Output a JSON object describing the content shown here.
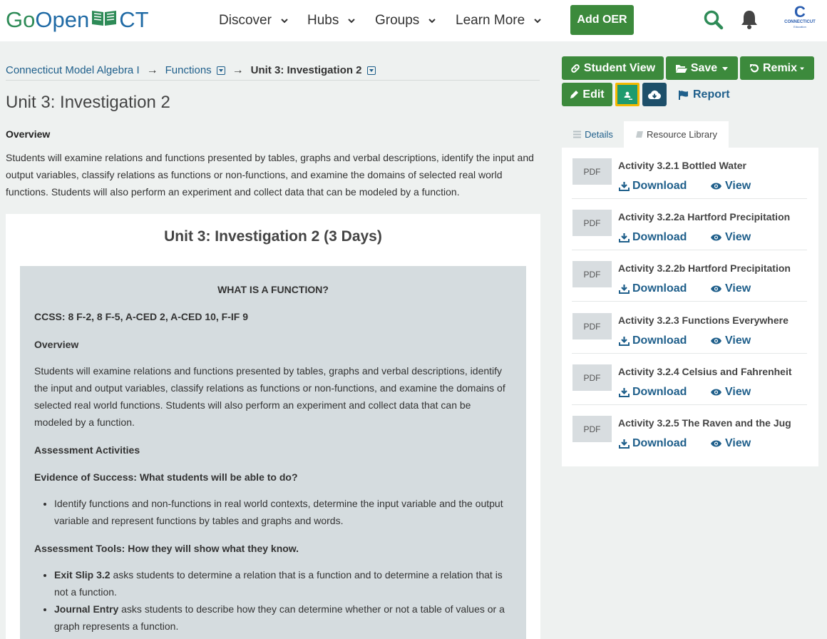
{
  "header": {
    "logo": {
      "go": "Go",
      "open": "Open",
      "ct": "CT"
    },
    "nav": [
      {
        "label": "Discover"
      },
      {
        "label": "Hubs"
      },
      {
        "label": "Groups"
      },
      {
        "label": "Learn More"
      }
    ],
    "add_oer": "Add OER",
    "state_logo": {
      "letter": "C",
      "line1": "CONNECTICUT",
      "line2": "Education"
    }
  },
  "breadcrumb": {
    "item1": "Connecticut Model Algebra I",
    "item2": "Functions",
    "item3": "Unit 3: Investigation 2",
    "separator": "→"
  },
  "page": {
    "title": "Unit 3: Investigation 2",
    "overview_label": "Overview",
    "overview_text": "Students will examine relations and functions presented by tables, graphs and verbal descriptions, identify the input and output variables, classify relations as functions or non-functions, and examine the domains of selected real world functions. Students will also perform an experiment and collect data that can be modeled by a function."
  },
  "card": {
    "title": "Unit 3: Investigation 2 (3 Days)",
    "heading": "WHAT IS A FUNCTION?",
    "ccss": "CCSS:  8 F-2, 8 F-5, A-CED 2, A-CED 10, F-IF 9",
    "overview_label": "Overview",
    "overview_text": "Students will examine relations and functions presented by tables, graphs and verbal descriptions, identify the input and output variables, classify relations as functions or non-functions, and examine the domains of selected real world functions. Students will also perform an experiment and collect data that can be modeled by a function.",
    "assessment_label": "Assessment Activities",
    "evidence_label": "Evidence of Success: What students will be able to do?",
    "evidence_items": [
      "Identify functions and non-functions in real world contexts, determine the input variable and the output variable and represent functions by tables and graphs and words."
    ],
    "tools_label": "Assessment Tools: How they will show what they know.",
    "tools_items": [
      {
        "bold": "Exit Slip 3.2",
        "text": " asks students to determine a relation that is a function and to determine a relation that is not a function."
      },
      {
        "bold": "Journal Entry",
        "text": " asks students to describe how they can determine whether or not a table of values or a graph represents a function."
      }
    ]
  },
  "actions": {
    "student_view": "Student View",
    "save": "Save",
    "remix": "Remix",
    "edit": "Edit",
    "report": "Report"
  },
  "tabs": {
    "details": "Details",
    "library": "Resource Library"
  },
  "resources": {
    "pdf_label": "PDF",
    "download_label": "Download",
    "view_label": "View",
    "items": [
      {
        "name": "Activity 3.2.1 Bottled Water"
      },
      {
        "name": "Activity 3.2.2a Hartford Precipitation"
      },
      {
        "name": "Activity 3.2.2b Hartford Precipitation"
      },
      {
        "name": "Activity 3.2.3 Functions Everywhere"
      },
      {
        "name": "Activity 3.2.4 Celsius and Fahrenheit"
      },
      {
        "name": "Activity 3.2.5 The Raven and the Jug"
      }
    ]
  },
  "colors": {
    "brand_green": "#3c8a3c",
    "link_blue": "#1f5f8b",
    "dark_teal": "#1d4f6a",
    "classroom_yellow": "#f3b800"
  }
}
